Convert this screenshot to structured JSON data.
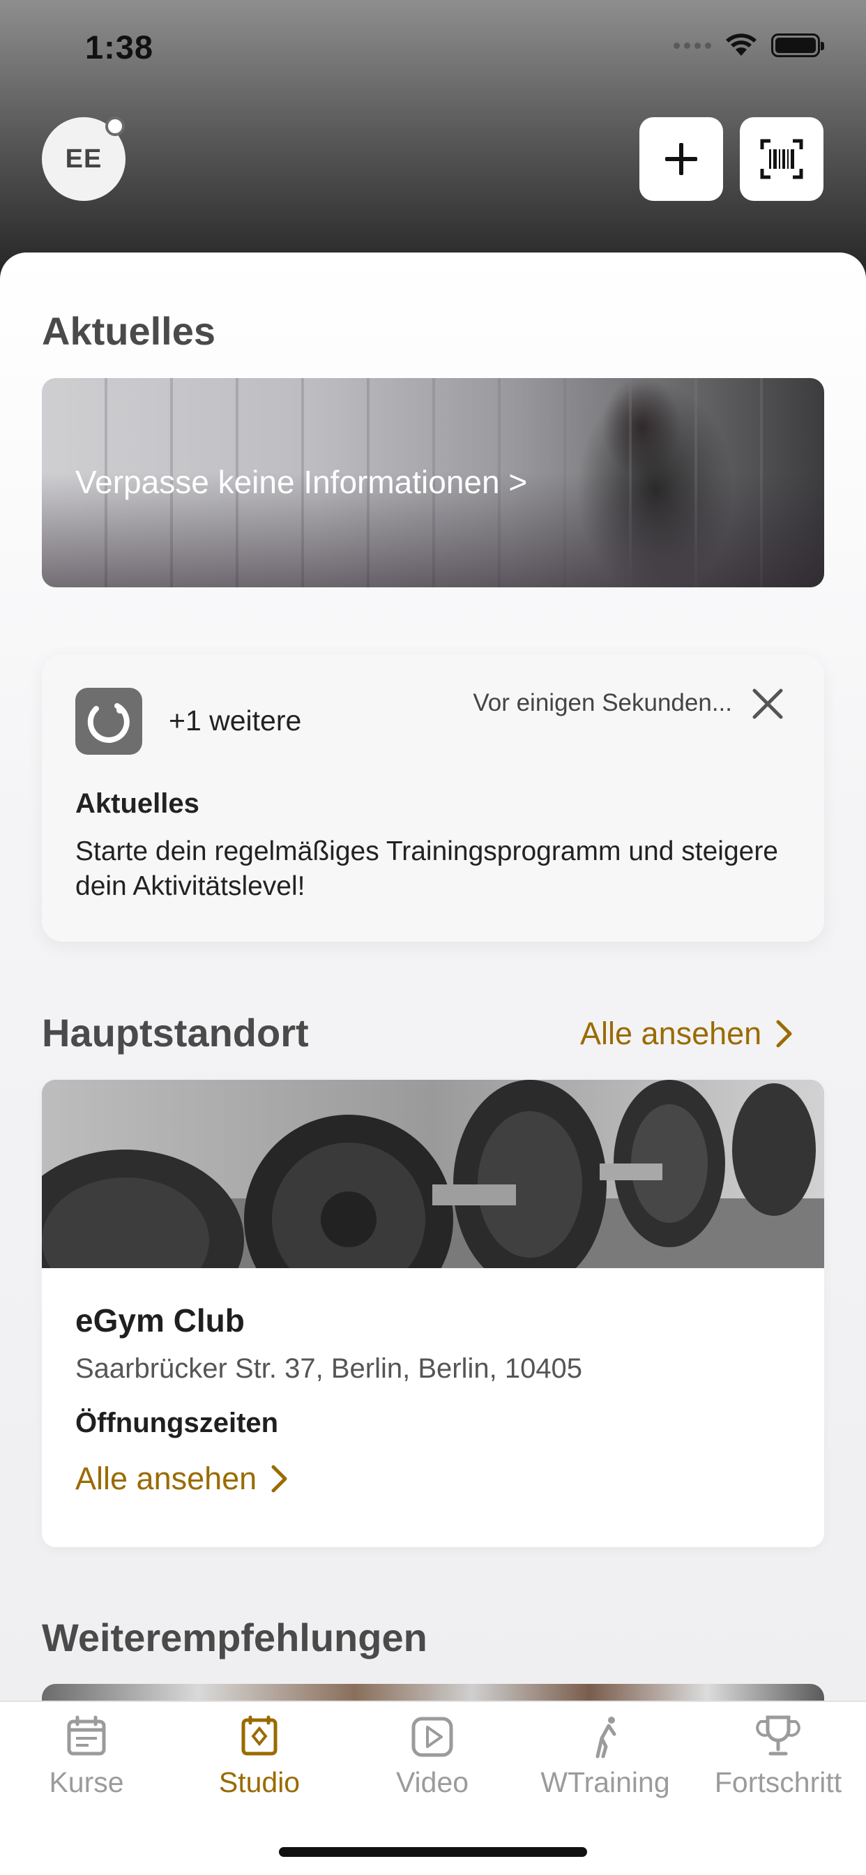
{
  "status_bar": {
    "time": "1:38"
  },
  "header": {
    "avatar_initials": "EE",
    "add_icon": "plus-icon",
    "scan_icon": "barcode-scan-icon"
  },
  "news": {
    "title": "Aktuelles",
    "banner_text": "Verpasse keine Informationen >"
  },
  "notification": {
    "more": "+1 weitere",
    "time": "Vor einigen Sekunden...",
    "title": "Aktuelles",
    "body": "Starte dein regelmäßiges Trainingsprogramm und steigere dein Aktivitätslevel!"
  },
  "main_location": {
    "title": "Hauptstandort",
    "see_all": "Alle ansehen",
    "gym": {
      "name": "eGym Club",
      "address": "Saarbrücker Str. 37, Berlin, Berlin, 10405",
      "hours_label": "Öffnungszeiten",
      "hours_link": "Alle ansehen"
    }
  },
  "recommendations": {
    "title": "Weiterempfehlungen"
  },
  "tabs": [
    {
      "label": "Kurse",
      "icon": "calendar-icon",
      "active": false
    },
    {
      "label": "Studio",
      "icon": "studio-icon",
      "active": true
    },
    {
      "label": "Video",
      "icon": "play-icon",
      "active": false
    },
    {
      "label": "WTraining",
      "icon": "exercise-icon",
      "active": false
    },
    {
      "label": "Fortschritt",
      "icon": "trophy-icon",
      "active": false
    }
  ],
  "colors": {
    "accent": "#9a6b00",
    "inactive_tab": "#9b9b9b"
  }
}
